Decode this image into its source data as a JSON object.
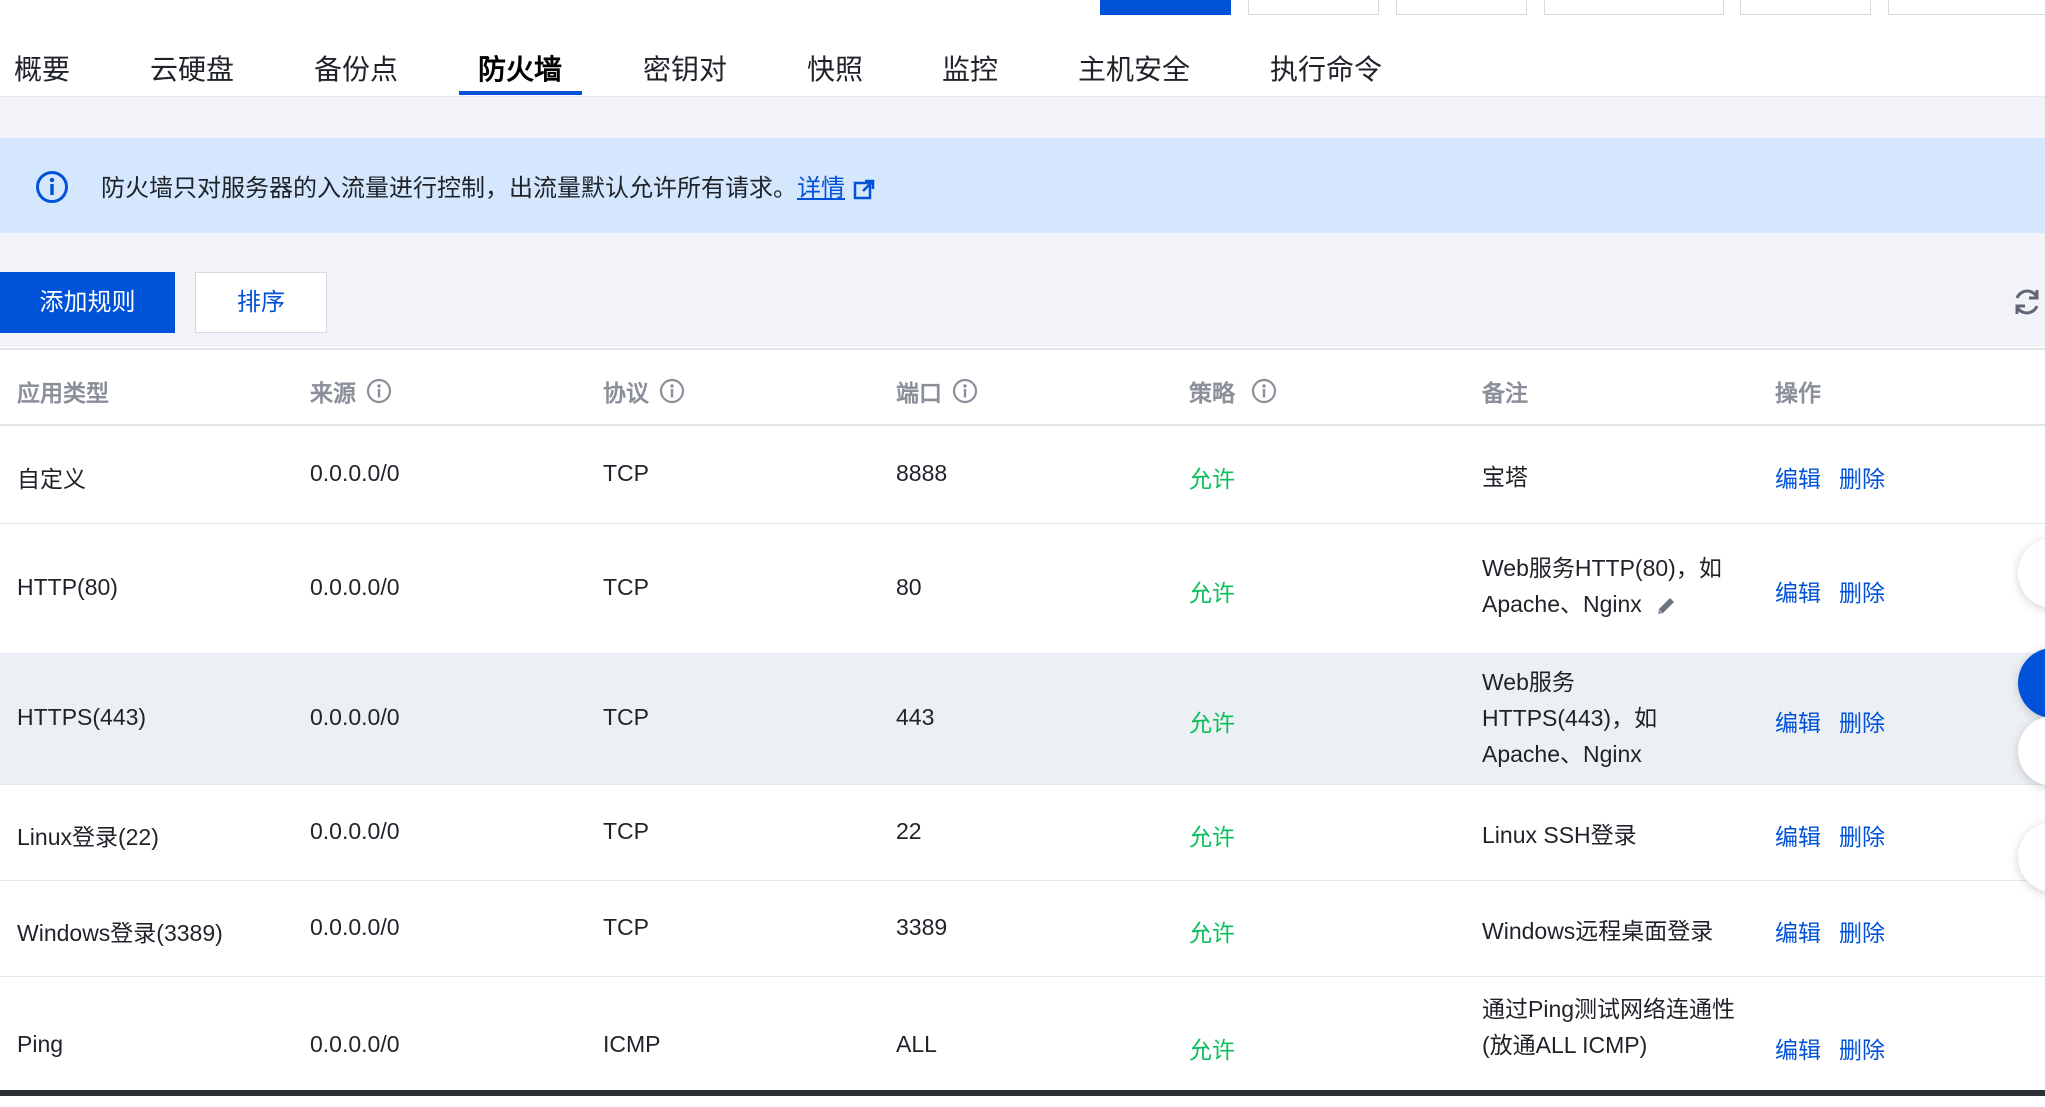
{
  "tabs": [
    {
      "label": "概要"
    },
    {
      "label": "云硬盘"
    },
    {
      "label": "备份点"
    },
    {
      "label": "防火墙",
      "active": true
    },
    {
      "label": "密钥对"
    },
    {
      "label": "快照"
    },
    {
      "label": "监控"
    },
    {
      "label": "主机安全"
    },
    {
      "label": "执行命令"
    }
  ],
  "banner": {
    "text": "防火墙只对服务器的入流量进行控制，出流量默认允许所有请求。",
    "link": "详情",
    "icon": "info-circle-icon",
    "link_icon": "external-link-icon"
  },
  "toolbar": {
    "add_label": "添加规则",
    "sort_label": "排序",
    "refresh_icon": "refresh-icon"
  },
  "table": {
    "headers": [
      "应用类型",
      "来源",
      "协议",
      "端口",
      "策略",
      "备注",
      "操作"
    ],
    "rows": [
      {
        "type": "自定义",
        "source": "0.0.0.0/0",
        "protocol": "TCP",
        "port": "8888",
        "policy": "允许",
        "note": "宝塔",
        "edit": "编辑",
        "delete": "删除"
      },
      {
        "type": "HTTP(80)",
        "source": "0.0.0.0/0",
        "protocol": "TCP",
        "port": "80",
        "policy": "允许",
        "note": "Web服务HTTP(80)，如Apache、Nginx",
        "edit": "编辑",
        "delete": "删除"
      },
      {
        "type": "HTTPS(443)",
        "source": "0.0.0.0/0",
        "protocol": "TCP",
        "port": "443",
        "policy": "允许",
        "note": "Web服务HTTPS(443)，如Apache、Nginx",
        "edit": "编辑",
        "delete": "删除"
      },
      {
        "type": "Linux登录(22)",
        "source": "0.0.0.0/0",
        "protocol": "TCP",
        "port": "22",
        "policy": "允许",
        "note": "Linux SSH登录",
        "edit": "编辑",
        "delete": "删除"
      },
      {
        "type": "Windows登录(3389)",
        "source": "0.0.0.0/0",
        "protocol": "TCP",
        "port": "3389",
        "policy": "允许",
        "note": "Windows远程桌面登录",
        "edit": "编辑",
        "delete": "删除"
      },
      {
        "type": "Ping",
        "source": "0.0.0.0/0",
        "protocol": "ICMP",
        "port": "ALL",
        "policy": "允许",
        "note": "通过Ping测试网络连通性(放通ALL ICMP)",
        "edit": "编辑",
        "delete": "删除"
      }
    ]
  },
  "colors": {
    "primary": "#0052d9",
    "allow": "#0abf5b",
    "banner_bg": "#d5e7fd"
  }
}
